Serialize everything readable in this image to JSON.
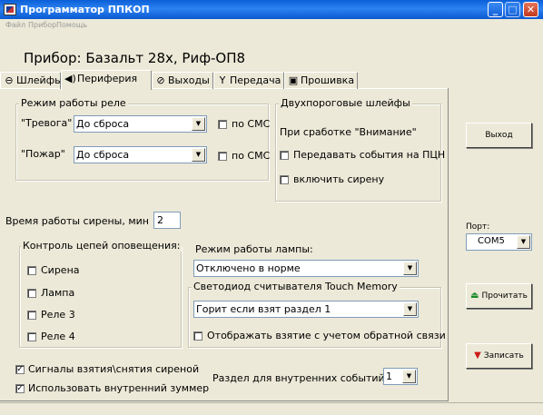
{
  "window": {
    "title": "Программатор ППКОП"
  },
  "menu": {
    "items": [
      "Файл",
      "Прибор",
      "Помощь"
    ]
  },
  "device_title": "Прибор: Базальт 28х, Риф-ОП8",
  "tabs": [
    {
      "label": "Шлейфы",
      "icon": "⊖",
      "icon_name": "loop-icon"
    },
    {
      "label": "Периферия",
      "icon": "◀)",
      "icon_name": "speaker-icon"
    },
    {
      "label": "Выходы",
      "icon": "⊘",
      "icon_name": "outputs-icon"
    },
    {
      "label": "Передача",
      "icon": "Y",
      "icon_name": "antenna-icon"
    },
    {
      "label": "Прошивка",
      "icon": "▣",
      "icon_name": "firmware-icon"
    }
  ],
  "relay_mode": {
    "title": "Режим работы реле",
    "alarm_label": "\"Тревога\"",
    "alarm_value": "До сброса",
    "alarm_sms_label": "по СМС",
    "alarm_sms_checked": false,
    "fire_label": "\"Пожар\"",
    "fire_value": "До сброса",
    "fire_sms_label": "по СМС",
    "fire_sms_checked": false
  },
  "two_threshold": {
    "title": "Двухпороговые шлейфы",
    "subtitle": "При сработке \"Внимание\"",
    "send_events_label": "Передавать события на ПЦН",
    "send_events_checked": false,
    "siren_label": "включить сирену",
    "siren_checked": false
  },
  "siren_time": {
    "label": "Время работы сирены, мин",
    "value": "2"
  },
  "alert_circuits": {
    "title": "Контроль цепей оповещения:",
    "items": [
      {
        "label": "Сирена",
        "checked": false
      },
      {
        "label": "Лампа",
        "checked": false
      },
      {
        "label": "Реле 3",
        "checked": false
      },
      {
        "label": "Реле 4",
        "checked": false
      }
    ]
  },
  "lamp_mode": {
    "label": "Режим работы лампы:",
    "value": "Отключено в норме"
  },
  "touch_memory": {
    "title": "Светодиод считывателя Touch Memory",
    "value": "Горит если взят раздел 1",
    "feedback_label": "Отображать взятие с учетом обратной связи",
    "feedback_checked": false
  },
  "options": {
    "siren_signals_label": "Сигналы взятия\\снятия сиреной",
    "siren_signals_checked": true,
    "buzzer_label": "Использовать внутренний зуммер",
    "buzzer_checked": true
  },
  "internal_events": {
    "label": "Раздел для внутренних событий",
    "value": "1"
  },
  "right_panel": {
    "exit_label": "Выход",
    "port_label": "Порт:",
    "port_value": "COM5",
    "read_label": "Прочитать",
    "write_label": "Записать"
  },
  "colors": {
    "accent_read": "#1a8a2a",
    "accent_write": "#cc1a1a",
    "title_bar": "#0a5fd8"
  }
}
